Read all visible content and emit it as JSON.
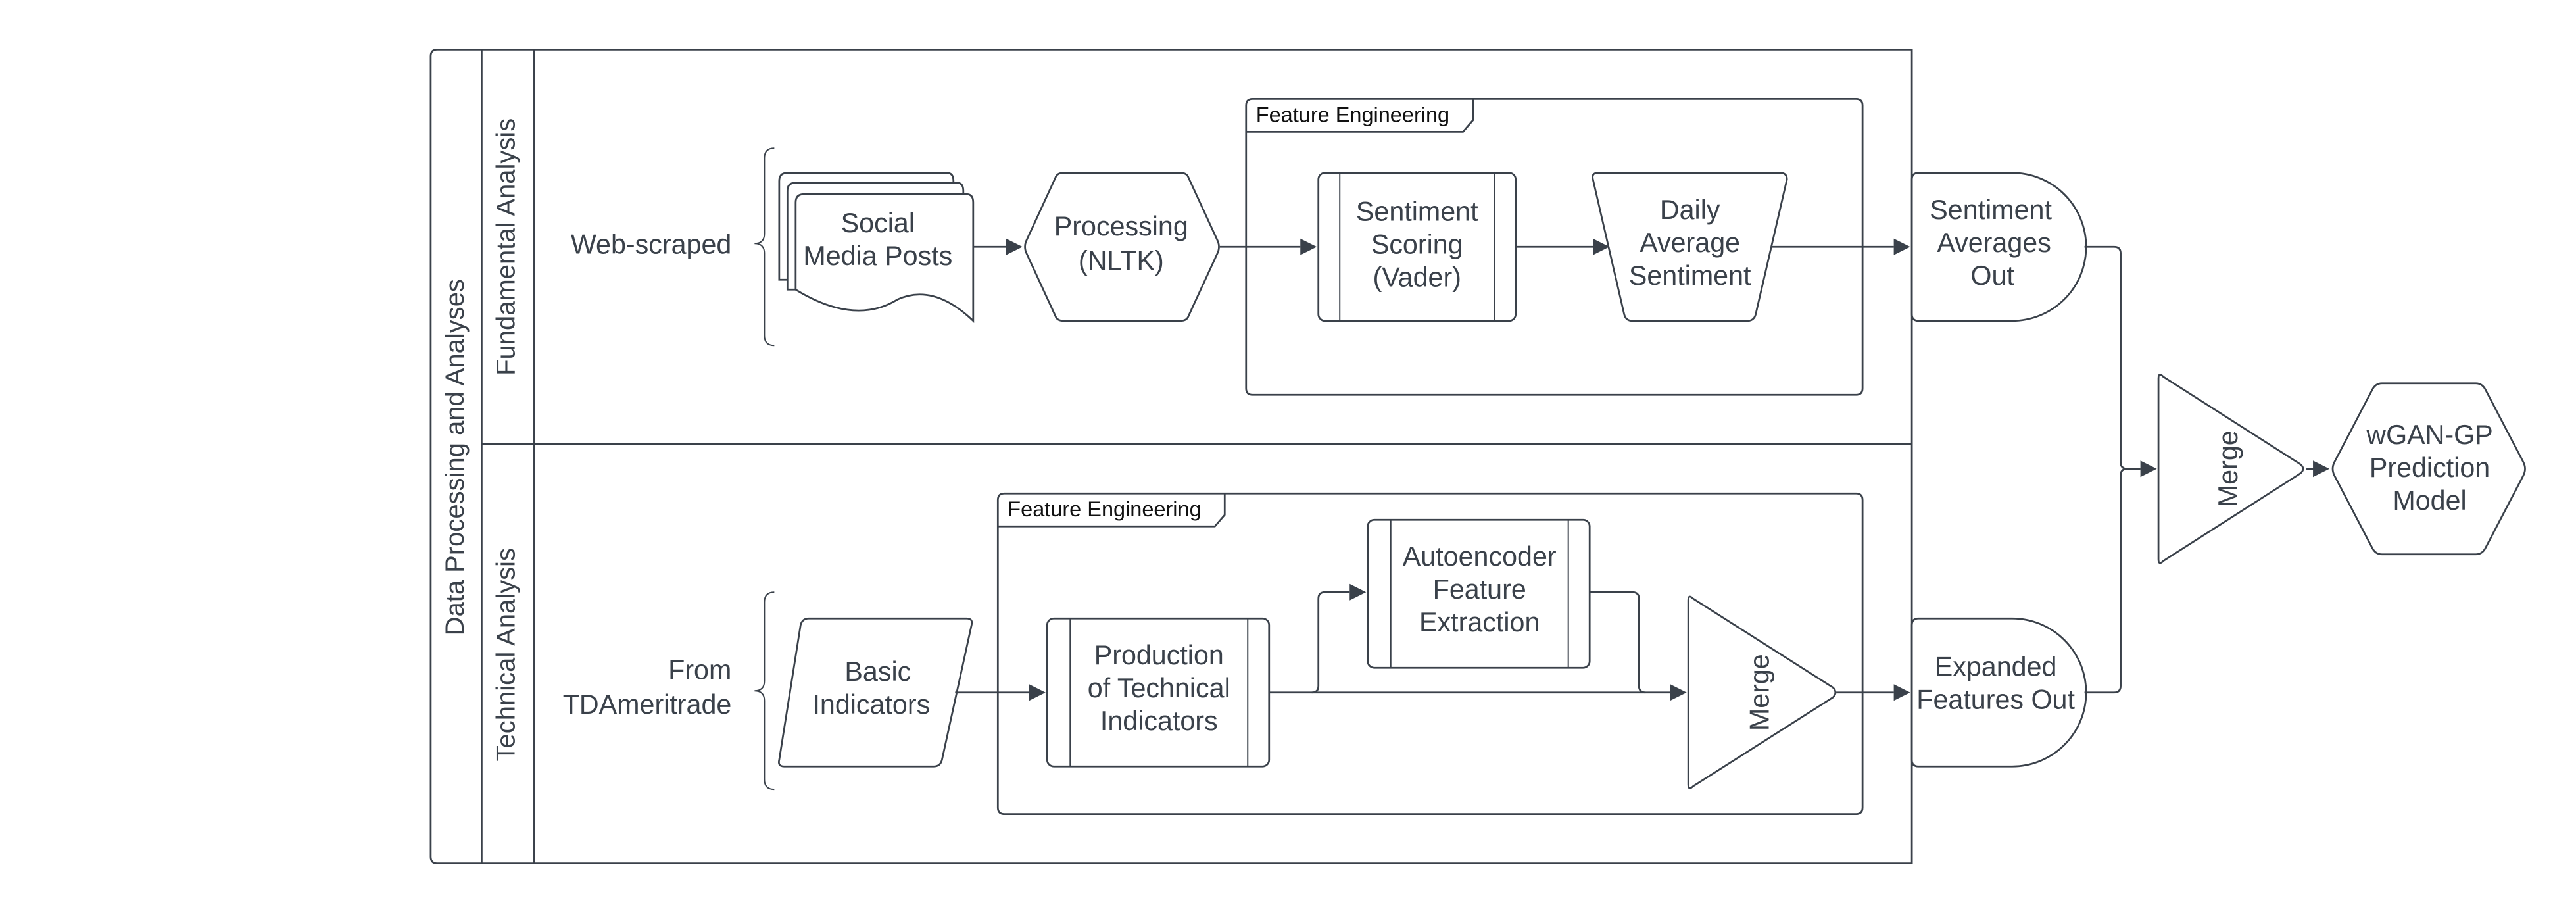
{
  "diagram": {
    "pool_title": "Data Processing and Analyses",
    "lanes": [
      {
        "id": "fundamental",
        "title": "Fundamental Analysis"
      },
      {
        "id": "technical",
        "title": "Technical Analysis"
      }
    ],
    "fundamental": {
      "source_label": "Web-scraped",
      "nodes": {
        "social_media": [
          "Social",
          "Media Posts"
        ],
        "processing": [
          "Processing",
          "(NLTK)"
        ],
        "sentiment_scoring": [
          "Sentiment",
          "Scoring",
          "(Vader)"
        ],
        "daily_average": [
          "Daily",
          "Average",
          "Sentiment"
        ]
      },
      "group_label": "Feature Engineering"
    },
    "technical": {
      "source_label": [
        "From",
        "TDAmeritrade"
      ],
      "nodes": {
        "basic_indicators": [
          "Basic",
          "Indicators"
        ],
        "production": [
          "Production",
          "of Technical",
          "Indicators"
        ],
        "autoencoder": [
          "Autoencoder",
          "Feature",
          "Extraction"
        ],
        "merge": "Merge"
      },
      "group_label": "Feature Engineering"
    },
    "outputs": {
      "sentiment_out": [
        "Sentiment",
        "Averages",
        "Out"
      ],
      "expanded_out": [
        "Expanded",
        "Features Out"
      ]
    },
    "final": {
      "merge": "Merge",
      "model": [
        "wGAN-GP",
        "Prediction",
        "Model"
      ]
    },
    "colors": {
      "stroke": "#3a414a",
      "background": "#ffffff"
    }
  }
}
